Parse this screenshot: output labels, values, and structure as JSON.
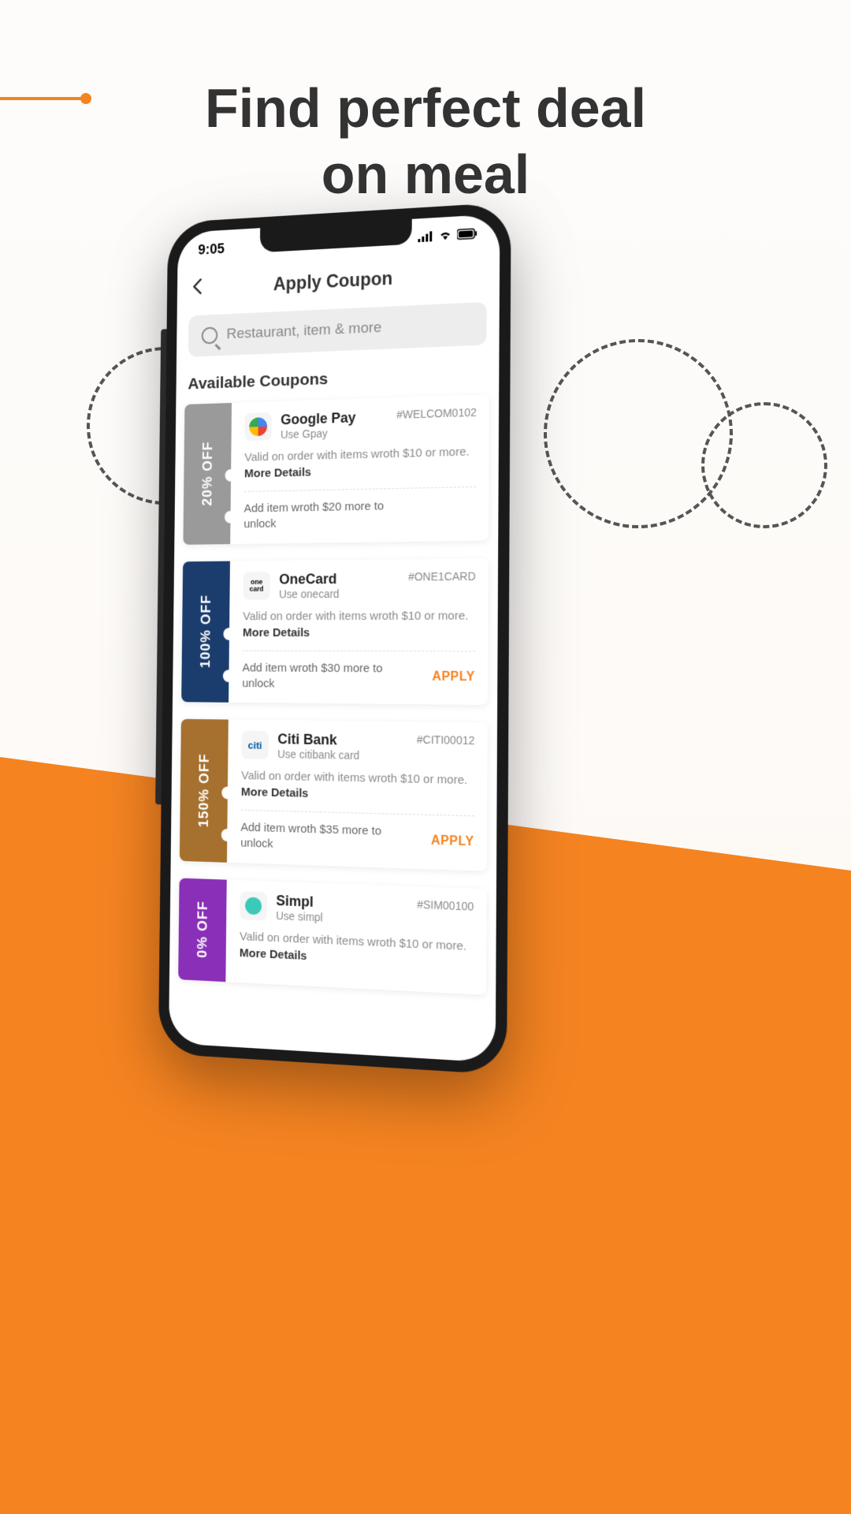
{
  "headline_line1": "Find perfect deal",
  "headline_line2": "on meal",
  "status": {
    "time": "9:05"
  },
  "header": {
    "title": "Apply Coupon"
  },
  "search": {
    "placeholder": "Restaurant, item & more"
  },
  "section": {
    "title": "Available Coupons"
  },
  "coupons": [
    {
      "discount": "20% OFF",
      "brand": "Google Pay",
      "sub": "Use Gpay",
      "code": "#WELCOM0102",
      "desc_pre": "Valid on order with items wroth $10 or more. ",
      "more": "More Details",
      "unlock": "Add item wroth $20 more to unlock",
      "apply": ""
    },
    {
      "discount": "100% OFF",
      "brand": "OneCard",
      "sub": "Use onecard",
      "code": "#ONE1CARD",
      "desc_pre": "Valid on order with items wroth $10 or more. ",
      "more": "More Details",
      "unlock": "Add item wroth $30 more to unlock",
      "apply": "APPLY"
    },
    {
      "discount": "150% OFF",
      "brand": "Citi Bank",
      "sub": "Use citibank card",
      "code": "#CITI00012",
      "desc_pre": "Valid on order with items wroth $10 or more. ",
      "more": "More Details",
      "unlock": "Add item wroth $35 more to unlock",
      "apply": "APPLY"
    },
    {
      "discount": "0% OFF",
      "brand": "Simpl",
      "sub": "Use simpl",
      "code": "#SIM00100",
      "desc_pre": "Valid on order with items wroth $10 or more. ",
      "more": "More Details",
      "unlock": "",
      "apply": ""
    }
  ]
}
